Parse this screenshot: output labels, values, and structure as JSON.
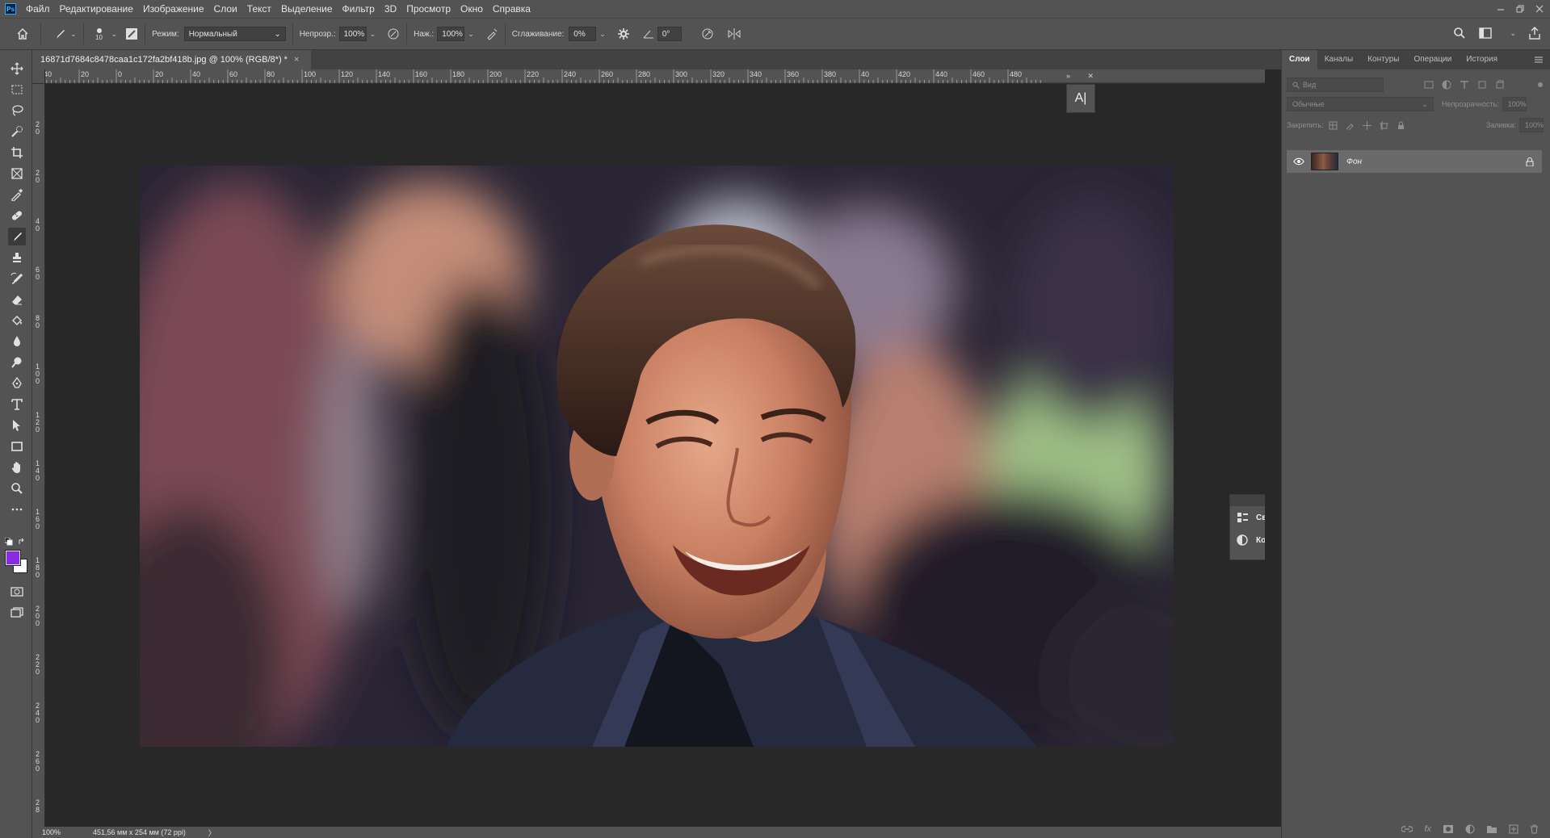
{
  "menu": {
    "logo": "Ps",
    "items": [
      "Файл",
      "Редактирование",
      "Изображение",
      "Слои",
      "Текст",
      "Выделение",
      "Фильтр",
      "3D",
      "Просмотр",
      "Окно",
      "Справка"
    ]
  },
  "options": {
    "brush_size": "10",
    "mode_label": "Режим:",
    "mode_value": "Нормальный",
    "opacity_label": "Непрозр.:",
    "opacity_value": "100%",
    "pressure_label": "Наж.:",
    "pressure_value": "100%",
    "smoothing_label": "Сглаживание:",
    "smoothing_value": "0%",
    "angle_value": "0°"
  },
  "document": {
    "tab_title": "16871d7684c8478caa1c172fa2bf418b.jpg @ 100% (RGB/8*) *",
    "tab_close": "×"
  },
  "rulers": {
    "h_ticks": [
      "40",
      "20",
      "0",
      "20",
      "40",
      "60",
      "80",
      "100",
      "120",
      "140",
      "160",
      "180",
      "200",
      "220",
      "240",
      "260",
      "280",
      "300",
      "320",
      "340",
      "360",
      "380",
      "40",
      "420",
      "440",
      "460",
      "480"
    ],
    "v_ticks": [
      "0",
      "2 0",
      "2 0",
      "4 0",
      "6 0",
      "8 0",
      "1 0 0",
      "1 2 0",
      "1 4 0",
      "1 6 0",
      "1 8 0",
      "2 0 0",
      "2 2 0",
      "2 4 0",
      "2 6 0",
      "2 8"
    ]
  },
  "float_panel": {
    "properties_label": "Свойства",
    "corrections_label": "Коррекц..."
  },
  "char_panel": {
    "glyph": "A|"
  },
  "status": {
    "zoom": "100%",
    "doc_size": "451,56 мм x 254 мм (72 ppi)",
    "arrow": "〉"
  },
  "right_panel": {
    "tabs": [
      "Слои",
      "Каналы",
      "Контуры",
      "Операции",
      "История"
    ],
    "search_placeholder": "Вид",
    "blend_mode": "Обычные",
    "opacity_label": "Непрозрачность:",
    "opacity_value": "100%",
    "lock_label": "Закрепить:",
    "fill_label": "Заливка:",
    "fill_value": "100%",
    "layer_name": "Фон"
  },
  "colors": {
    "foreground": "#8a2be2",
    "background": "#ffffff",
    "ui_bg": "#535353",
    "canvas_bg": "#282828"
  }
}
